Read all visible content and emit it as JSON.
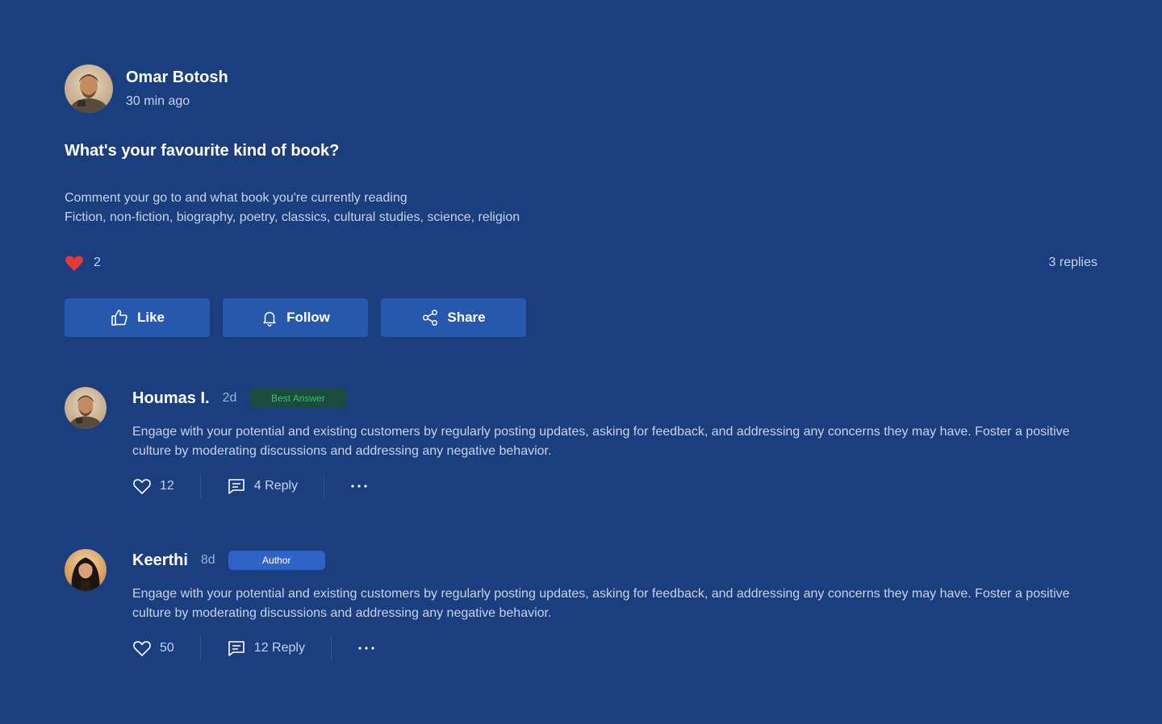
{
  "post": {
    "author_name": "Omar Botosh",
    "author_time": "30 min ago",
    "title": "What's your favourite kind of book?",
    "body_lines": [
      "Comment your go to and what book you're currently reading",
      "Fiction, non-fiction, biography, poetry, classics, cultural studies, science, religion"
    ],
    "likes": "2",
    "replies": "3 replies"
  },
  "actions": {
    "like_label": "Like",
    "follow_label": "Follow",
    "share_label": "Share"
  },
  "comments": [
    {
      "name": "Houmas I.",
      "age": "2d",
      "badge": "Best Answer",
      "text": "Engage with your potential and existing customers by regularly posting updates, asking for feedback, and addressing any concerns they may have. Foster a positive culture by moderating discussions and addressing any negative behavior.",
      "likes": "12",
      "replies": "4 Reply"
    },
    {
      "name": "Keerthi",
      "age": "8d",
      "badge": "Author",
      "text": "Engage with your potential and existing customers by regularly posting updates, asking for feedback, and addressing any concerns they may have. Foster a positive culture by moderating discussions and addressing any negative behavior.",
      "likes": "50",
      "replies": "12 Reply"
    }
  ],
  "colors": {
    "background": "#1a3e7e",
    "button": "#2659ad",
    "heart": "#e53935",
    "best_badge_bg": "#1b4b3d",
    "best_badge_text": "#35c46a",
    "author_badge_bg": "#2f63c7"
  }
}
